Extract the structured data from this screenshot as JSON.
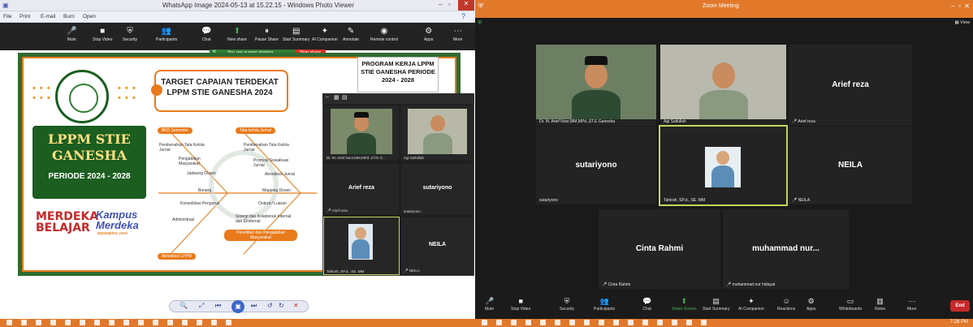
{
  "viewer": {
    "window_title": "WhatsApp Image 2024-05-13 at 15.22.15 - Windows Photo Viewer",
    "menu": [
      "File",
      "Print",
      "E-mail",
      "Burn",
      "Open"
    ],
    "zoom_toolbar": [
      {
        "label": "Mute",
        "icon": "microphone-icon",
        "glyph": "🎤"
      },
      {
        "label": "Stop Video",
        "icon": "camera-icon",
        "glyph": "■"
      },
      {
        "label": "Security",
        "icon": "shield-icon",
        "glyph": "⛨"
      },
      {
        "label": "Participants",
        "icon": "participants-icon",
        "glyph": "👥"
      },
      {
        "label": "Chat",
        "icon": "chat-icon",
        "glyph": "💬"
      },
      {
        "label": "New share",
        "icon": "share-icon",
        "glyph": "⬆"
      },
      {
        "label": "Pause Share",
        "icon": "pause-icon",
        "glyph": "⏸"
      },
      {
        "label": "Start Summary",
        "icon": "summary-icon",
        "glyph": "▤"
      },
      {
        "label": "AI Companion",
        "icon": "sparkle-icon",
        "glyph": "✦"
      },
      {
        "label": "Annotate",
        "icon": "pen-icon",
        "glyph": "✎"
      },
      {
        "label": "Remote control",
        "icon": "mouse-icon",
        "glyph": "◉"
      },
      {
        "label": "Apps",
        "icon": "apps-icon",
        "glyph": "⚙"
      },
      {
        "label": "More",
        "icon": "more-icon",
        "glyph": "⋯"
      }
    ],
    "share_banner": "You are screen sharing",
    "stop_share": "Stop share",
    "slide": {
      "lppm_title": "LPPM STIE GANESHA",
      "period": "PERIODE 2024 - 2028",
      "merdeka": "MERDEKA BELAJAR",
      "kampus": "Kampus Merdeka",
      "kampus_sub": "INDONESIA JAYA",
      "target_title": "TARGET CAPAIAN TERDEKAT LPPM STIE GANESHA 2024",
      "program_title": "PROGRAM KERJA LPPM STIE GANESHA PERIODE 2024 - 2028",
      "pills": [
        "BKD Semester",
        "Tata kelola Jurnal",
        "Akreditasi LPPM",
        "Penelitian dan Pengabdian Masyarakat"
      ],
      "items_left": [
        "Pembenahan Tata Kelola Jurnal",
        "Pengabdian Masyarakat",
        "Jadwung Dosen",
        "Borang",
        "Konsolidasi Pengurus",
        "Administrasi"
      ],
      "items_right": [
        "Pembenahan Tata Kelola Jurnal",
        "Promosi Sosialisasi Jurnal",
        "Akreditasi Jurnal",
        "Mapping Dosen",
        "Output / Luaran",
        "Sinergi dan Kolaborasi Internal dan Eksternal"
      ]
    },
    "float_tiles": [
      {
        "name": "Dr. M. Arief Noor,MM,MPd.,ST.E G...",
        "type": "video"
      },
      {
        "name": "Agi Saifullah",
        "type": "video"
      },
      {
        "name": "Arief reza",
        "center": "Arief reza",
        "muted": true
      },
      {
        "name": "sutariyono",
        "center": "sutariyono",
        "muted": false
      },
      {
        "name": "Tahirah, SP.d., SE. MM",
        "type": "video"
      },
      {
        "name": "NEILA",
        "center": "NEILA",
        "muted": true
      }
    ]
  },
  "zoom": {
    "window_title": "Zoom Meeting",
    "view_label": "View",
    "tiles": [
      {
        "name": "Dr. M. Arief Noor,MM,MPd.,ST.E Ganesha",
        "type": "video"
      },
      {
        "name": "Agi Saifullah",
        "type": "video"
      },
      {
        "name": "Arief reza",
        "center": "Arief reza",
        "muted": true
      },
      {
        "name": "sutariyono",
        "center": "sutariyono",
        "muted": false
      },
      {
        "name": "Tahirah, SP.d., SE. MM",
        "type": "video",
        "active": true
      },
      {
        "name": "NEILA",
        "center": "NEILA",
        "muted": true
      },
      {
        "name": "Cinta Rahmi",
        "center": "Cinta Rahmi",
        "muted": true
      },
      {
        "name": "muhammad nur hidayat",
        "center": "muhammad  nur...",
        "muted": true
      }
    ],
    "toolbar": [
      {
        "label": "Mute",
        "icon": "microphone-icon",
        "glyph": "🎤"
      },
      {
        "label": "Stop Video",
        "icon": "camera-icon",
        "glyph": "■"
      },
      {
        "label": "Security",
        "icon": "shield-icon",
        "glyph": "⛨"
      },
      {
        "label": "Participants",
        "icon": "participants-icon",
        "glyph": "👥"
      },
      {
        "label": "Chat",
        "icon": "chat-icon",
        "glyph": "💬"
      },
      {
        "label": "Share Screen",
        "icon": "share-icon",
        "glyph": "⬆"
      },
      {
        "label": "Start Summary",
        "icon": "summary-icon",
        "glyph": "▤"
      },
      {
        "label": "AI Companion",
        "icon": "sparkle-icon",
        "glyph": "✦"
      },
      {
        "label": "Reactions",
        "icon": "reactions-icon",
        "glyph": "☺"
      },
      {
        "label": "Apps",
        "icon": "apps-icon",
        "glyph": "⚙"
      },
      {
        "label": "Whiteboards",
        "icon": "whiteboard-icon",
        "glyph": "▭"
      },
      {
        "label": "Notes",
        "icon": "notes-icon",
        "glyph": "▥"
      },
      {
        "label": "More",
        "icon": "more-icon",
        "glyph": "⋯"
      }
    ],
    "end_label": "End",
    "clock": "7:28 PM"
  },
  "colors": {
    "accent_green": "#2e7d32",
    "slide_orange": "#e97a1b",
    "zoom_highlight": "#c4d65f",
    "end_red": "#c62828",
    "taskbar": "#e1782a"
  }
}
